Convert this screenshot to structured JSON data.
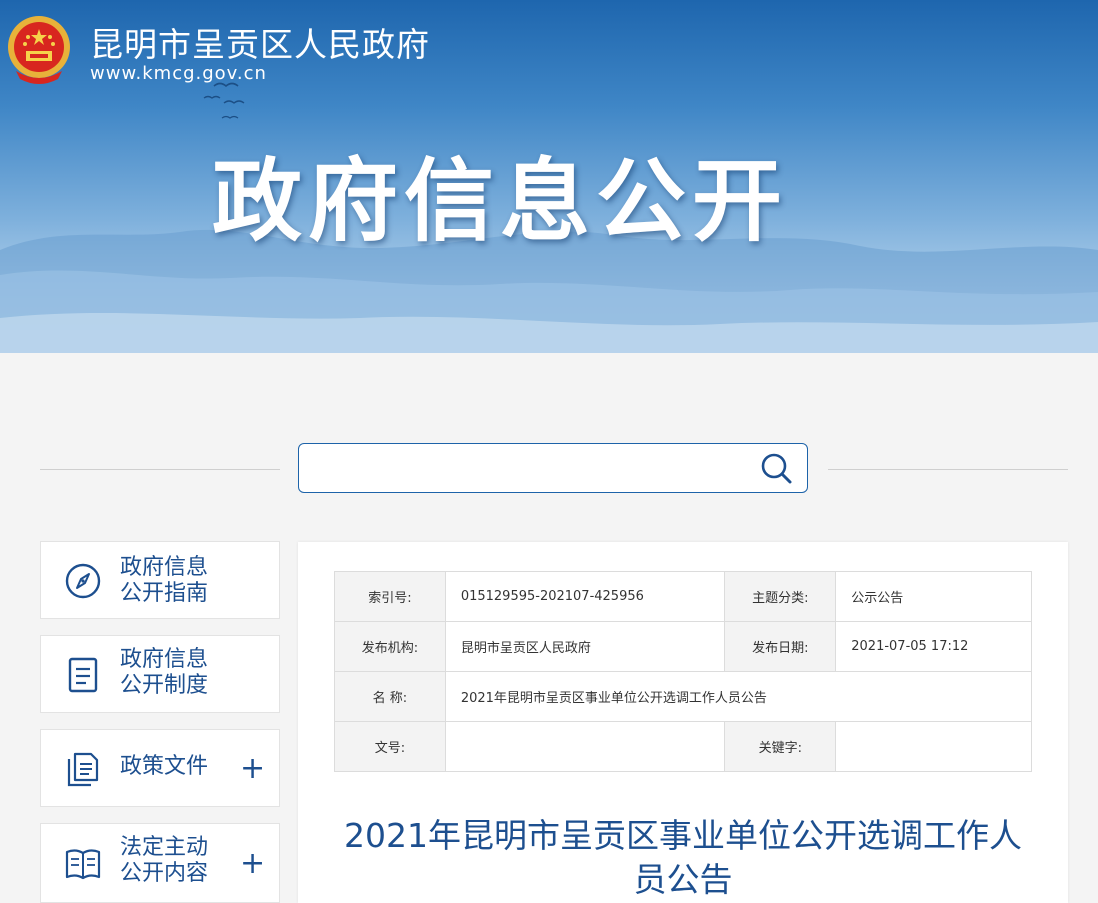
{
  "header": {
    "site_name": "昆明市呈贡区人民政府",
    "site_url": "www.kmcg.gov.cn",
    "section_title": "政府信息公开"
  },
  "search": {
    "placeholder": "",
    "icon": "search-icon"
  },
  "sidebar": {
    "items": [
      {
        "label": "政府信息\n公开指南",
        "icon": "compass-icon",
        "expandable": false
      },
      {
        "label": "政府信息\n公开制度",
        "icon": "document-icon",
        "expandable": false
      },
      {
        "label": "政策文件",
        "icon": "files-icon",
        "expandable": true,
        "expand_symbol": "+"
      },
      {
        "label": "法定主动\n公开内容",
        "icon": "book-icon",
        "expandable": true,
        "expand_symbol": "+"
      }
    ]
  },
  "meta_table": {
    "index_no_label": "索引号:",
    "index_no": "015129595-202107-425956",
    "topic_label": "主题分类:",
    "topic": "公示公告",
    "publisher_label": "发布机构:",
    "publisher": "昆明市呈贡区人民政府",
    "publish_date_label": "发布日期:",
    "publish_date": "2021-07-05 17:12",
    "name_label": "名 称:",
    "name": "2021年昆明市呈贡区事业单位公开选调工作人员公告",
    "doc_no_label": "文号:",
    "doc_no": "",
    "keywords_label": "关键字:",
    "keywords": ""
  },
  "document": {
    "title": "2021年昆明市呈贡区事业单位公开选调工作人员公告"
  },
  "colors": {
    "brand_blue": "#1d4f8f",
    "search_border": "#1d63a9",
    "label_bg": "#f3f3f3"
  }
}
